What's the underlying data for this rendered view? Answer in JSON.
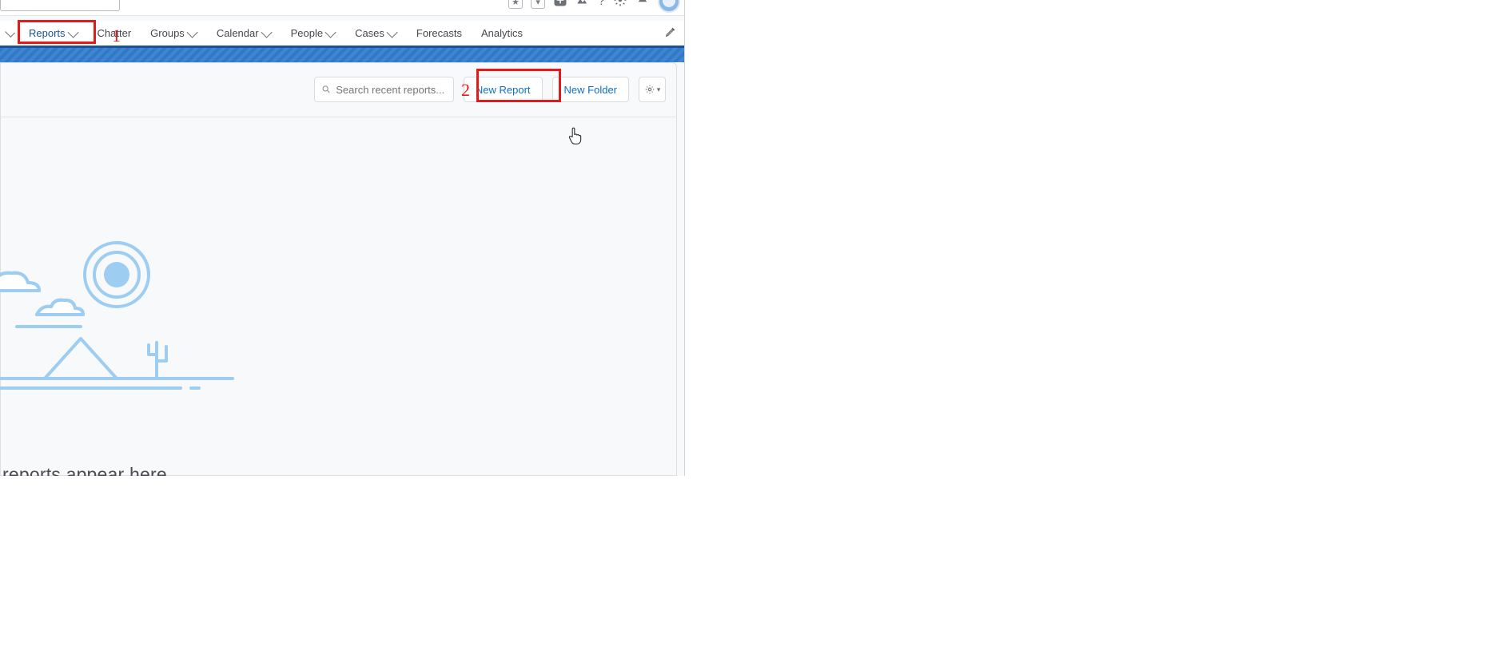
{
  "nav": {
    "items": [
      {
        "label": "",
        "has_caret": true
      },
      {
        "label": "Reports",
        "has_caret": true,
        "active": true
      },
      {
        "label": "Chatter",
        "has_caret": false
      },
      {
        "label": "Groups",
        "has_caret": true
      },
      {
        "label": "Calendar",
        "has_caret": true
      },
      {
        "label": "People",
        "has_caret": true
      },
      {
        "label": "Cases",
        "has_caret": true
      },
      {
        "label": "Forecasts",
        "has_caret": false
      },
      {
        "label": "Analytics",
        "has_caret": false
      }
    ]
  },
  "search": {
    "placeholder": "Search recent reports..."
  },
  "buttons": {
    "new_report": "New Report",
    "new_folder": "New Folder"
  },
  "empty_state_text": "reports appear here",
  "annotations": {
    "step1": "1",
    "step2": "2"
  },
  "util_icons": {
    "star": "star-icon",
    "star_caret": "star-dropdown-icon",
    "plus": "plus-icon",
    "trailhead": "trailhead-icon",
    "help": "help-icon",
    "setup": "setup-gear-icon",
    "notifications": "bell-icon",
    "avatar": "user-avatar-icon"
  }
}
